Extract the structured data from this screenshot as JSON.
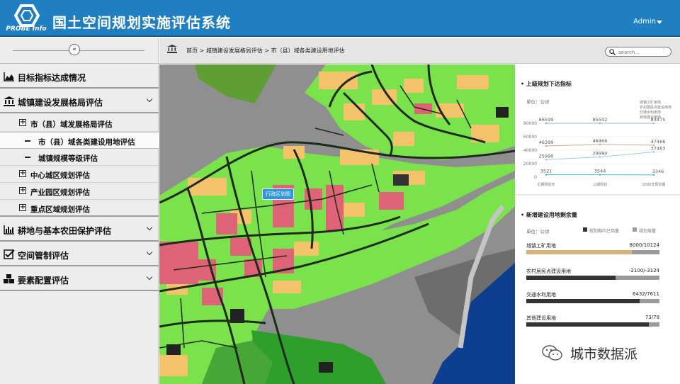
{
  "header": {
    "logo_text": "PROBE Info",
    "title": "国土空间规划实施评估系统",
    "user": "Admin"
  },
  "sidebar": {
    "items": [
      {
        "label": "目标指标达成情况",
        "icon": "area-chart-icon"
      },
      {
        "label": "城镇建设发展格局评估",
        "icon": "bank-icon"
      },
      {
        "label": "耕地与基本农田保护评估",
        "icon": "bar-chart-icon"
      },
      {
        "label": "空间管制评估",
        "icon": "check-square-icon"
      },
      {
        "label": "要素配置评估",
        "icon": "cubes-icon"
      }
    ],
    "subitems": [
      {
        "label": "市（县）域发展格局评估"
      },
      {
        "label": "市（县）域各类建设用地评估"
      },
      {
        "label": "城镇规模等级评估"
      },
      {
        "label": "中心城区规划评估"
      },
      {
        "label": "产业园区规划评估"
      },
      {
        "label": "重点区域规划评估"
      }
    ]
  },
  "breadcrumb": {
    "text": "首页  >  城镇建设发展格局评估 > 市（县）域各类建设用地评估"
  },
  "search": {
    "placeholder": "search..."
  },
  "map": {
    "label": "行政区划图"
  },
  "panel1": {
    "title": "上级规划下达指标",
    "unit": "单位：公顷",
    "legend": [
      "城镇工矿用地",
      "农村居民点建设用地",
      "交通水利用地",
      "其他建设用地"
    ],
    "yticks": [
      "80000",
      "60000",
      "40000",
      "20000",
      "0"
    ],
    "xticks": [
      "近期规划年",
      "三期规划",
      "2030年规划期"
    ]
  },
  "chart_data": {
    "type": "line",
    "x": [
      "近期规划年",
      "三期规划",
      "2030年规划期"
    ],
    "ylim": [
      0,
      80000
    ],
    "series": [
      {
        "name": "城镇工矿用地",
        "values": [
          86599,
          85502,
          83475
        ]
      },
      {
        "name": "农村居民点建设用地",
        "values": [
          46399,
          48466,
          47466
        ]
      },
      {
        "name": "交通水利用地",
        "values": [
          25990,
          29990,
          37463
        ]
      },
      {
        "name": "其他建设用地",
        "values": [
          3521,
          3544,
          3346
        ]
      }
    ],
    "value_labels": [
      [
        "86599",
        "85502",
        "83475"
      ],
      [
        "46399",
        "48466",
        "47466"
      ],
      [
        "25990",
        "29990",
        "37463"
      ],
      [
        "3521",
        "3544",
        "3346"
      ]
    ]
  },
  "panel2": {
    "title": "新增建设用地剩余量",
    "unit": "单位：公顷",
    "legend": [
      "规划期内已用量",
      "规划增量"
    ],
    "bars": [
      {
        "name": "城镇工矿用地",
        "value": "8000/10124",
        "fraction": 0.79,
        "color": "#d9b27a"
      },
      {
        "name": "农村居民点建设用地",
        "value": "-2100/-3124",
        "fraction": 0.67,
        "color": "#333333"
      },
      {
        "name": "交通水利用地",
        "value": "6432/7611",
        "fraction": 0.85,
        "color": "#333333"
      },
      {
        "name": "其他建设用地",
        "value": "73/79",
        "fraction": 0.92,
        "color": "#333333"
      }
    ]
  },
  "watermark": {
    "text": "城市数据派"
  }
}
